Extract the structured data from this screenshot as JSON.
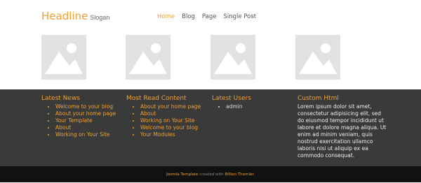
{
  "colors": {
    "accent": "#f0a030",
    "dark_footer": "#3a3a3a",
    "bottom_bar": "#111111",
    "placeholder": "#e2e2e2"
  },
  "header": {
    "headline": "Headline",
    "slogan": "Slogan"
  },
  "nav": {
    "items": [
      {
        "label": "Home"
      },
      {
        "label": "Blog"
      },
      {
        "label": "Page"
      },
      {
        "label": "Single Post"
      }
    ],
    "active": "Home"
  },
  "images": [
    {
      "icon": "image-placeholder-icon"
    },
    {
      "icon": "image-placeholder-icon"
    },
    {
      "icon": "image-placeholder-icon"
    },
    {
      "icon": "image-placeholder-icon"
    }
  ],
  "footer": {
    "latest_news": {
      "title": "Latest News",
      "items": [
        "Welcome to your blog",
        "About your home page",
        "Your Template",
        "About",
        "Working on Your Site"
      ]
    },
    "most_read": {
      "title": "Most Read Content",
      "items": [
        "About your home page",
        "About",
        "Working on Your Site",
        "Welcome to your blog",
        "Your Modules"
      ]
    },
    "latest_users": {
      "title": "Latest Users",
      "items": [
        "admin"
      ]
    },
    "custom_html": {
      "title": "Custom Html",
      "text": "Lorem ipsum dolor sit amet, consectetur adipisicing elit, sed do eiusmod tempor incididunt ut labore et dolore magna aliqua. Ut enim ad minim veniam, quis nostrud exercitation ullamco laboris nisi ut aliquip ex ea commodo consequat."
    }
  },
  "copyright": {
    "link1": "Joomla Template",
    "middle": " created with ",
    "link2": "Billion Themler."
  }
}
